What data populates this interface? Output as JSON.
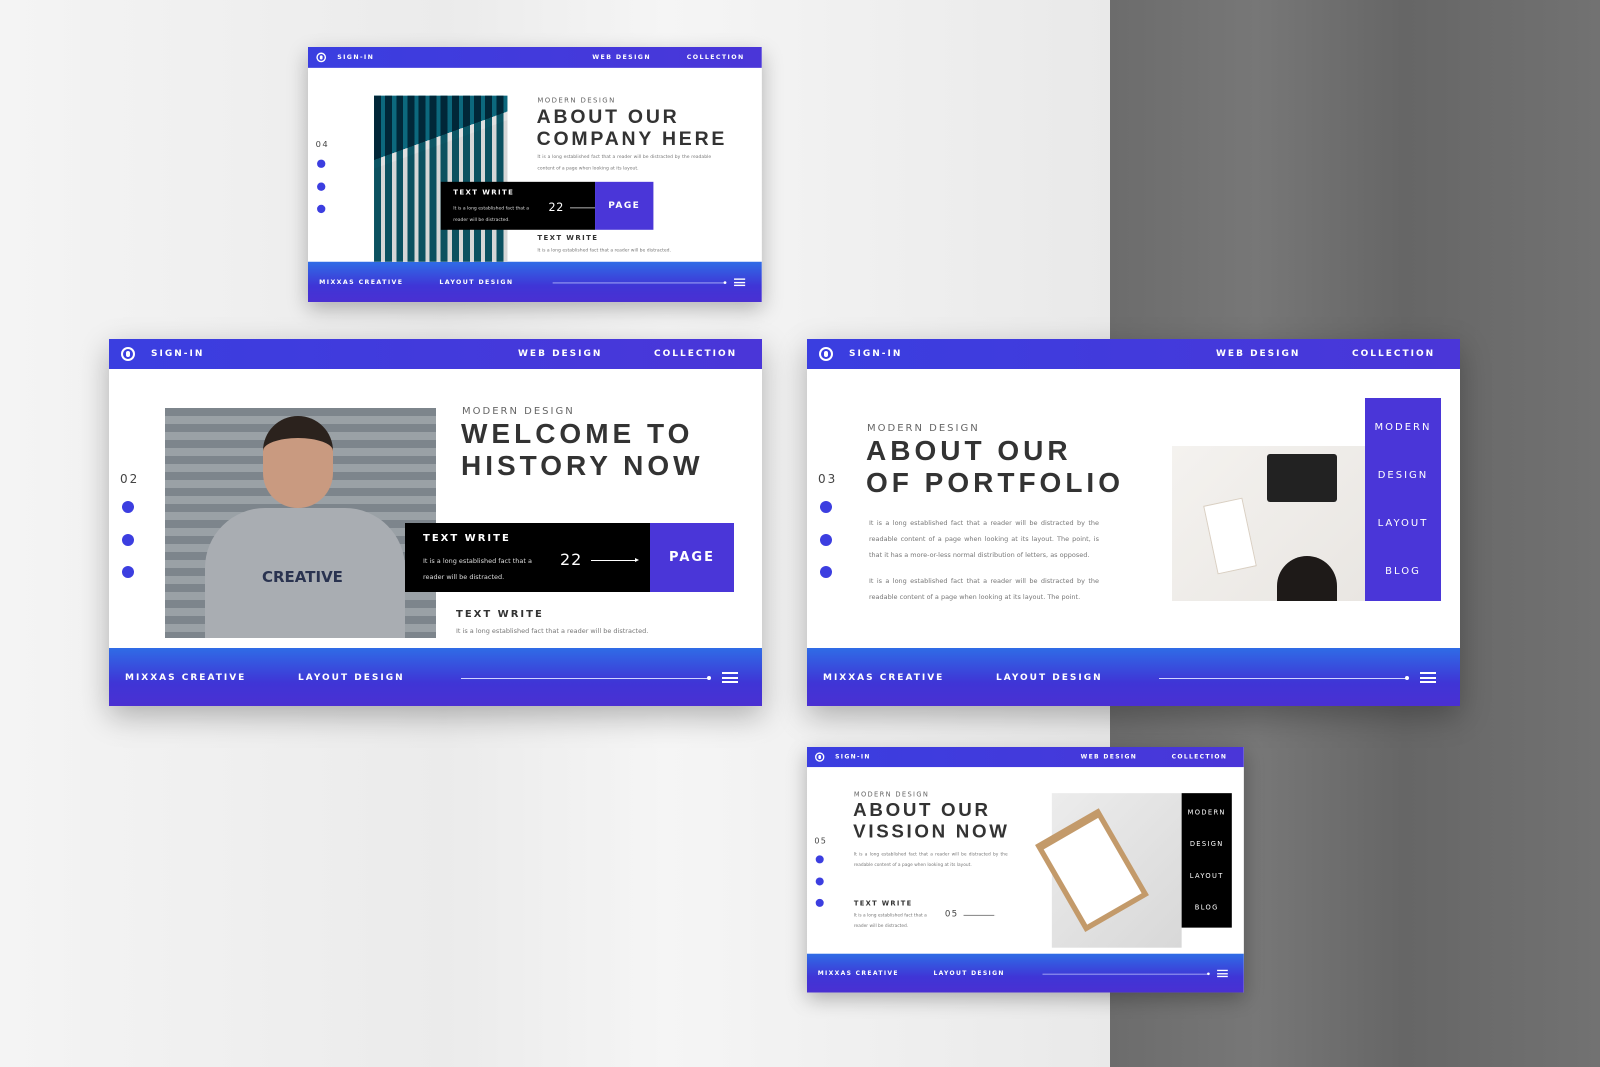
{
  "header": {
    "signin": "SIGN-IN",
    "web_design": "WEB DESIGN",
    "collection": "COLLECTION"
  },
  "footer": {
    "brand": "MIXXAS CREATIVE",
    "layout": "LAYOUT DESIGN"
  },
  "colors": {
    "accent": "#4a36d8",
    "header_blue": "#3a3ee0",
    "dark_box": "#000000",
    "title": "#333333"
  },
  "icons": {
    "header": "user-circle-icon",
    "footer": "hamburger-menu-icon",
    "arrow": "arrow-right-icon"
  },
  "slides": [
    {
      "number": "04",
      "subtitle": "MODERN DESIGN",
      "title": [
        "ABOUT OUR",
        "COMPANY HERE"
      ],
      "paragraphs": [
        "It is a long established fact that a reader will be distracted by the readable content of a page when looking at its layout."
      ],
      "box": {
        "title": "TEXT WRITE",
        "desc": "It is a long established fact that a reader will be distracted.",
        "value": "22",
        "button": "PAGE"
      },
      "text_write": {
        "title": "TEXT WRITE",
        "desc": "It is a long established fact that a reader will be distracted."
      }
    },
    {
      "number": "02",
      "subtitle": "MODERN DESIGN",
      "title": [
        "WELCOME TO",
        "HISTORY NOW"
      ],
      "box": {
        "title": "TEXT WRITE",
        "desc": "It is a long established fact that a reader will be distracted.",
        "value": "22",
        "button": "PAGE"
      },
      "text_write": {
        "title": "TEXT WRITE",
        "desc": "It is a long established fact that a reader will be distracted."
      },
      "photo_text": "CREATIVE"
    },
    {
      "number": "03",
      "subtitle": "MODERN DESIGN",
      "title": [
        "ABOUT OUR",
        "OF PORTFOLIO"
      ],
      "paragraphs": [
        "It is a long established fact that a reader will be distracted by the readable content of a page when looking at its layout. The point, is that it has a more-or-less normal distribution of letters, as opposed.",
        "It is a long established fact that a reader will be distracted by the readable content of a page when looking at its layout. The point."
      ],
      "menu": [
        "MODERN",
        "DESIGN",
        "LAYOUT",
        "BLOG"
      ]
    },
    {
      "number": "05",
      "subtitle": "MODERN DESIGN",
      "title": [
        "ABOUT OUR",
        "VISSION NOW"
      ],
      "paragraphs": [
        "It is a long established fact that a reader will be distracted by the readable content of a page when looking at its layout."
      ],
      "text_write": {
        "title": "TEXT WRITE",
        "desc": "It is a long established fact that a reader will be distracted.",
        "value": "05"
      },
      "menu": [
        "MODERN",
        "DESIGN",
        "LAYOUT",
        "BLOG"
      ]
    }
  ]
}
